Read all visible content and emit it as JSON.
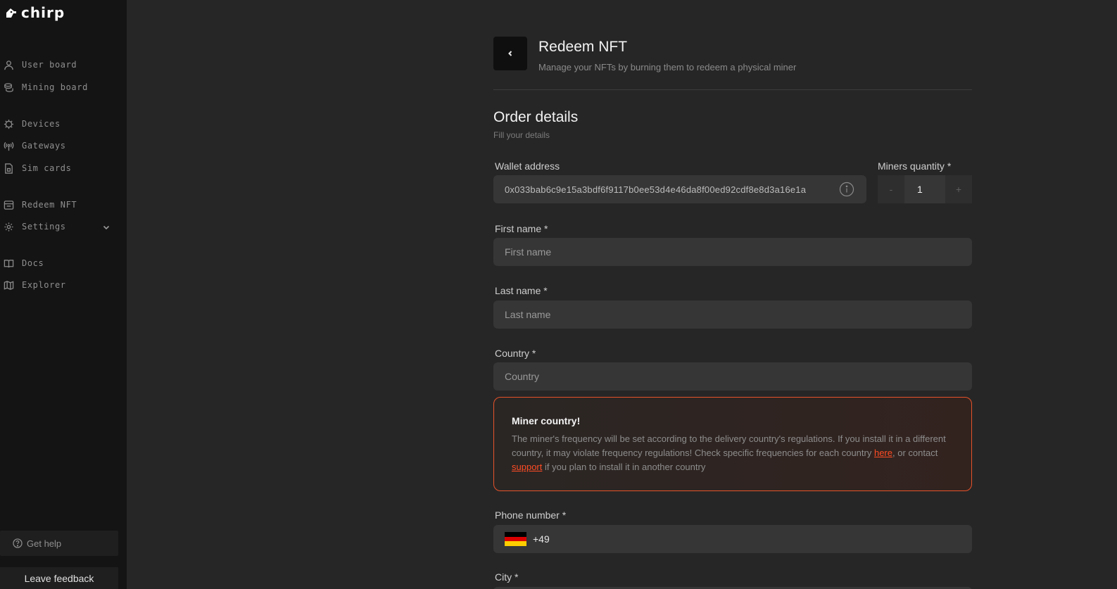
{
  "app": {
    "name": "chirp",
    "brand_color": "#ffffff",
    "accent_color": "#e5532b"
  },
  "sidebar": {
    "items": [
      {
        "label": "User board",
        "icon": "user-icon"
      },
      {
        "label": "Mining board",
        "icon": "coins-icon"
      },
      {
        "label": "Devices",
        "icon": "chip-icon"
      },
      {
        "label": "Gateways",
        "icon": "antenna-icon"
      },
      {
        "label": "Sim cards",
        "icon": "sim-card-icon"
      },
      {
        "label": "Redeem NFT",
        "icon": "ticket-icon"
      },
      {
        "label": "Settings",
        "icon": "gear-icon"
      },
      {
        "label": "Docs",
        "icon": "book-icon"
      },
      {
        "label": "Explorer",
        "icon": "map-icon"
      }
    ],
    "get_help": "Get help",
    "feedback": "Leave feedback"
  },
  "header": {
    "title": "Redeem NFT",
    "subtitle": "Manage your NFTs by burning them to redeem a physical miner"
  },
  "order": {
    "title": "Order details",
    "subtitle": "Fill your details"
  },
  "form": {
    "wallet_label": "Wallet address",
    "wallet_value": "0x033bab6c9e15a3bdf6f9117b0ee53d4e46da8f00ed92cdf8e8d3a16e1a",
    "quantity_label": "Miners quantity *",
    "quantity_value": "1",
    "quantity_minus": "-",
    "quantity_plus": "+",
    "first_name_label": "First name *",
    "first_name_placeholder": "First name",
    "last_name_label": "Last name *",
    "last_name_placeholder": "Last name",
    "country_label": "Country *",
    "country_placeholder": "Country",
    "phone_label": "Phone number *",
    "phone_code": "+49",
    "city_label": "City *"
  },
  "alert": {
    "title": "Miner country!",
    "body": "The miner's frequency will be set according to the delivery country's regulations. If you install it in a different country, it may violate frequency regulations! Check specific frequencies for each country",
    "link_here": "here",
    "text_contact": ", or contact ",
    "link_support": "support",
    "text_tail": " if you plan to install it in another country"
  }
}
